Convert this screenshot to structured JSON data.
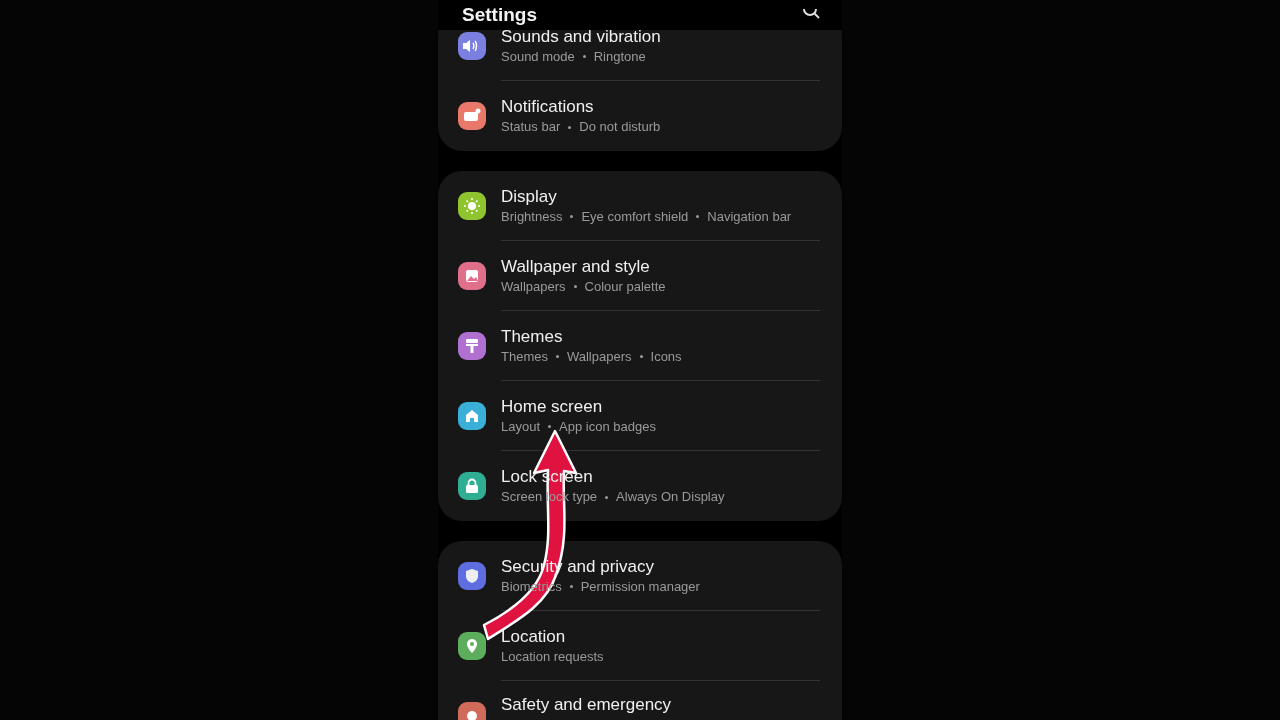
{
  "header": {
    "title": "Settings"
  },
  "groups": [
    {
      "items": [
        {
          "kind": "sound",
          "color": "#7b7fe0",
          "title": "Sounds and vibration",
          "subtitles": [
            "Sound mode",
            "Ringtone"
          ]
        },
        {
          "kind": "notification",
          "color": "#e8786a",
          "title": "Notifications",
          "subtitles": [
            "Status bar",
            "Do not disturb"
          ]
        }
      ]
    },
    {
      "items": [
        {
          "kind": "display",
          "color": "#8fc42e",
          "title": "Display",
          "subtitles": [
            "Brightness",
            "Eye comfort shield",
            "Navigation bar"
          ]
        },
        {
          "kind": "wallpaper",
          "color": "#e06f8b",
          "title": "Wallpaper and style",
          "subtitles": [
            "Wallpapers",
            "Colour palette"
          ]
        },
        {
          "kind": "themes",
          "color": "#b070d0",
          "title": "Themes",
          "subtitles": [
            "Themes",
            "Wallpapers",
            "Icons"
          ]
        },
        {
          "kind": "home",
          "color": "#3ab0d8",
          "title": "Home screen",
          "subtitles": [
            "Layout",
            "App icon badges"
          ]
        },
        {
          "kind": "lock",
          "color": "#2fae94",
          "title": "Lock screen",
          "subtitles": [
            "Screen lock type",
            "Always On Display"
          ]
        }
      ]
    },
    {
      "items": [
        {
          "kind": "security",
          "color": "#5e6ee0",
          "title": "Security and privacy",
          "subtitles": [
            "Biometrics",
            "Permission manager"
          ]
        },
        {
          "kind": "location",
          "color": "#5cae5c",
          "title": "Location",
          "subtitles": [
            "Location requests"
          ]
        },
        {
          "kind": "safety",
          "color": "#d06a5a",
          "title": "Safety and emergency"
        }
      ]
    }
  ]
}
